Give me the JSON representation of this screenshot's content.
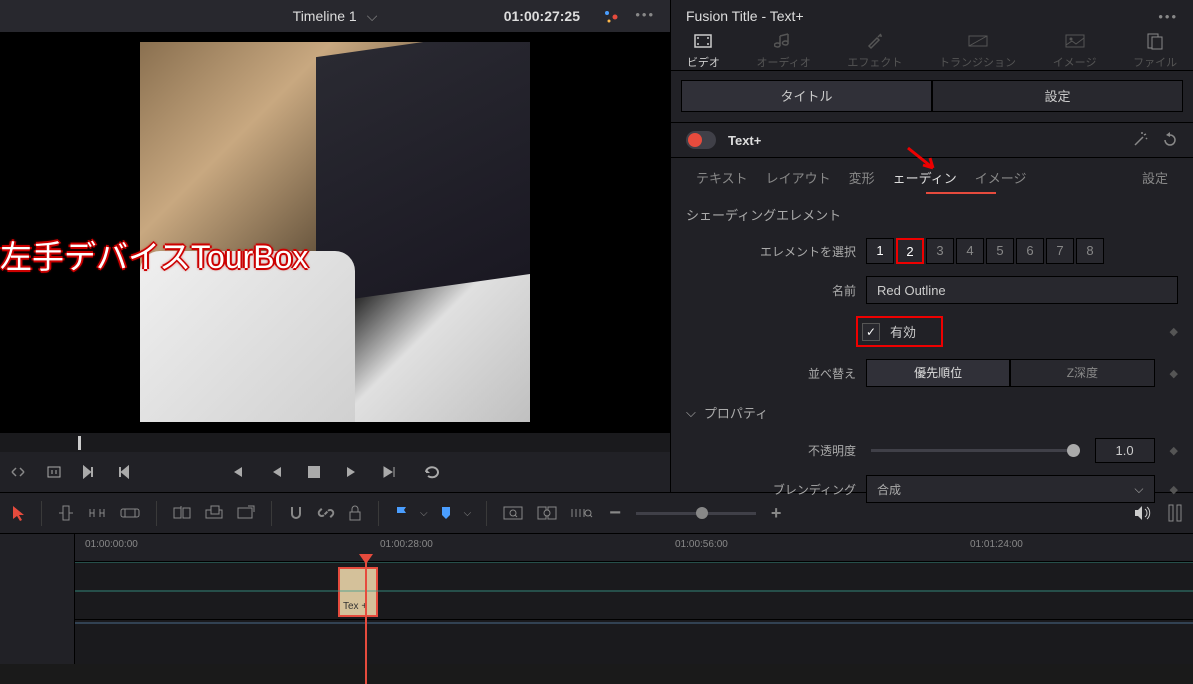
{
  "header": {
    "timeline_name": "Timeline 1",
    "timecode": "01:00:27:25",
    "inspector_title": "Fusion Title - Text+"
  },
  "viewer": {
    "overlay_text": "左手デバイスTourBox"
  },
  "inspector": {
    "tabs": {
      "video": "ビデオ",
      "audio": "オーディオ",
      "effect": "エフェクト",
      "transition": "トランジション",
      "image": "イメージ",
      "file": "ファイル"
    },
    "title_tab": "タイトル",
    "settings_tab": "設定",
    "text_plus": "Text+",
    "sub_tabs": {
      "text": "テキスト",
      "layout": "レイアウト",
      "transform": "変形",
      "shading": "ェーディン",
      "image": "イメージ",
      "settings": "設定"
    },
    "shading_section": "シェーディングエレメント",
    "select_element_label": "エレメントを選択",
    "elements": [
      "1",
      "2",
      "3",
      "4",
      "5",
      "6",
      "7",
      "8"
    ],
    "name_label": "名前",
    "name_value": "Red Outline",
    "enabled_label": "有効",
    "sort_label": "並べ替え",
    "sort_priority": "優先順位",
    "sort_zdepth": "Z深度",
    "properties_section": "プロパティ",
    "opacity_label": "不透明度",
    "opacity_value": "1.0",
    "blending_label": "ブレンディング",
    "blending_value": "合成"
  },
  "timeline": {
    "ticks": [
      "01:00:00:00",
      "01:00:28:00",
      "01:00:56:00",
      "01:01:24:00"
    ],
    "clip_label": "Tex +"
  }
}
